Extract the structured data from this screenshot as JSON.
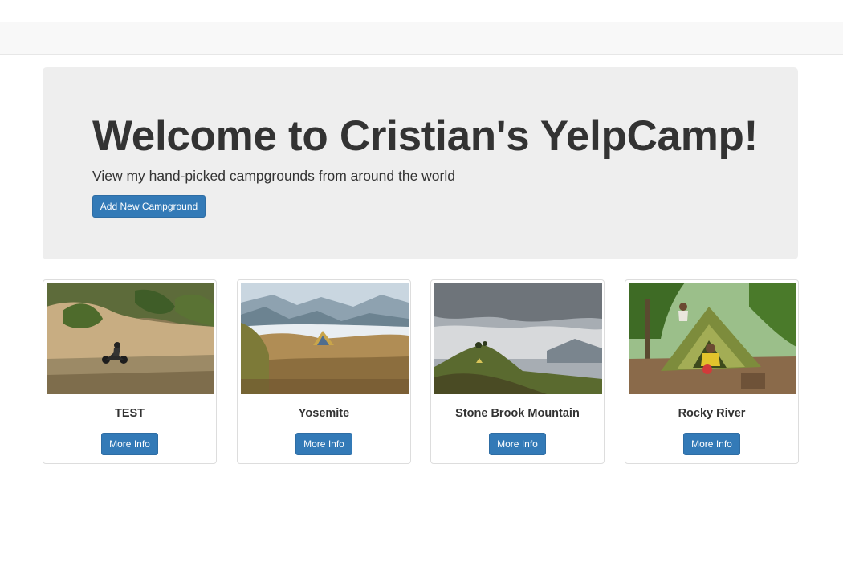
{
  "jumbotron": {
    "title": "Welcome to Cristian's YelpCamp!",
    "subtitle": "View my hand-picked campgrounds from around the world",
    "add_button_label": "Add New Campground"
  },
  "campgrounds": [
    {
      "name": "TEST",
      "button_label": "More Info"
    },
    {
      "name": "Yosemite",
      "button_label": "More Info"
    },
    {
      "name": "Stone Brook Mountain",
      "button_label": "More Info"
    },
    {
      "name": "Rocky River",
      "button_label": "More Info"
    }
  ],
  "colors": {
    "primary_button": "#337ab7",
    "jumbotron_bg": "#eeeeee",
    "navbar_bg": "#f8f8f8"
  }
}
